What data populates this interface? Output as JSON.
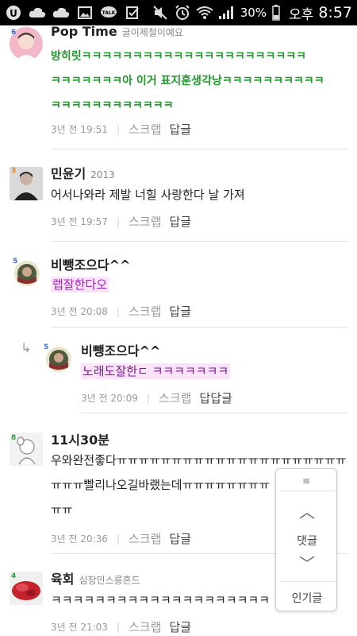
{
  "status": {
    "battery": "30%",
    "ampm": "오후",
    "time": "8:57",
    "left_icons": [
      "u-plus-icon",
      "cloud-icon",
      "cloud-icon",
      "image-icon",
      "talk-icon",
      "checkbox-icon"
    ],
    "right_icons": [
      "mute-icon",
      "alarm-icon",
      "wifi-icon",
      "signal-icon",
      "battery-icon"
    ]
  },
  "comments": [
    {
      "rank": "6",
      "nick": "Pop Time",
      "nick_sub": "글이제철이예요",
      "lines": [
        "방히릿ㅋㅋㅋㅋㅋㅋㅋㅋㅋㅋㅋㅋㅋㅋㅋㅋㅋㅋㅋㅋㅋㅋ",
        "ㅋㅋㅋㅋㅋㅋㅋ아 이거 표지훈생각낭ㅋㅋㅋㅋㅋㅋㅋㅋㅋㅋ",
        "ㅋㅋㅋㅋㅋㅋㅋㅋㅋㅋㅋㅋ"
      ],
      "time": "3년 전 19:51",
      "scrap": "스크랩",
      "reply": "답글"
    },
    {
      "rank": "3",
      "nick": "민윤기",
      "nick_sub": "2013",
      "lines": [
        "어서나와라 제발 너힐 사랑한다 날 가져"
      ],
      "time": "3년 전 19:57",
      "scrap": "스크랩",
      "reply": "답글"
    },
    {
      "rank": "5",
      "nick": "비뺑조으다^^",
      "nick_sub": "",
      "lines": [
        "랩잘한다오"
      ],
      "time": "3년 전 20:08",
      "scrap": "스크랩",
      "reply": "답글"
    },
    {
      "rank": "5",
      "nick": "비뺑조으다^^",
      "nick_sub": "",
      "lines": [
        "노래도잘한ㄷ ㅋㅋㅋㅋㅋㅋㅋ"
      ],
      "time": "3년 전 20:09",
      "scrap": "스크랩",
      "reply": "답답글"
    },
    {
      "rank": "8",
      "nick": "11시30분",
      "nick_sub": "",
      "lines": [
        "우와완전좋다ㅠㅠㅠㅠㅠㅠㅠㅠㅠㅠㅠㅠㅠㅠㅠㅠㅠㅠㅠㅠㅠ",
        "ㅠㅠㅠ빨리나오길바랬는데ㅠㅠㅠㅠㅠㅠㅠㅠ",
        "ㅠㅠ"
      ],
      "time": "3년 전 20:36",
      "scrap": "스크랩",
      "reply": "답글"
    },
    {
      "rank": "4",
      "nick": "육회",
      "nick_sub": "심창민스릉흔드",
      "lines": [
        "ㅋㅋㅋㅋㅋㅋㅋㅋㅋㅋㅋㅋㅋㅋㅋㅋㅋㅋㅋㅋ"
      ],
      "time": "3년 전 21:03",
      "scrap": "스크랩",
      "reply": "답글"
    }
  ],
  "floatnav": {
    "grip": "≡",
    "up": "︿",
    "comment_label": "댓글",
    "down": "﹀",
    "popular_label": "인기글"
  }
}
